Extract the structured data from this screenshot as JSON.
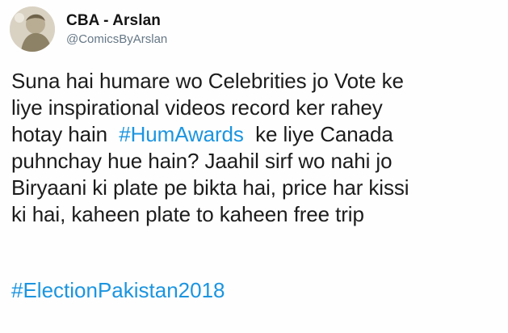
{
  "tweet": {
    "author": {
      "display_name": "CBA - Arslan",
      "handle": "@ComicsByArslan",
      "avatar_icon": "profile-photo"
    },
    "body": {
      "line1": "Suna hai humare wo Celebrities jo Vote ke",
      "line2": "liye inspirational videos record ker rahey",
      "line3_prefix": "hotay hain",
      "line3_hashtag": "#HumAwards",
      "line3_suffix": "ke liye Canada",
      "line4": "puhnchay hue hain? Jaahil sirf wo nahi jo",
      "line5": "Biryaani ki plate pe bikta hai, price har kissi",
      "line6": "ki hai, kaheen plate to kaheen free trip"
    },
    "footer_hashtag": "#ElectionPakistan2018"
  },
  "colors": {
    "hashtag": "#1b95e0",
    "text": "#1c1c1c",
    "handle": "#657786"
  }
}
